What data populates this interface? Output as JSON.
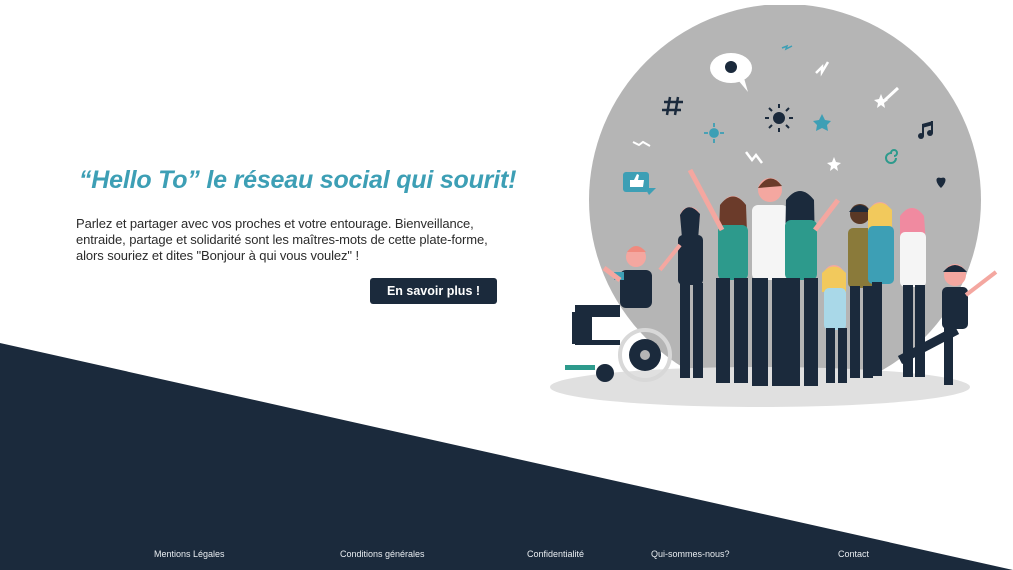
{
  "hero": {
    "title": "“Hello To” le réseau social qui sourit!",
    "description": "Parlez et partager avec vos proches et votre entourage. Bienveillance, entraide, partage et solidarité sont les maîtres-mots de cette plate-forme, alors souriez et dites \"Bonjour à qui vous voulez\" !",
    "cta_label": "En savoir plus !"
  },
  "footer": {
    "links": [
      {
        "label": "Mentions Légales"
      },
      {
        "label": "Conditions générales"
      },
      {
        "label": "Confidentialité"
      },
      {
        "label": "Qui-sommes-nous?"
      },
      {
        "label": "Contact"
      }
    ]
  },
  "colors": {
    "accent": "#3d9fb5",
    "dark": "#1b2a3c",
    "circle": "#b5b5b5",
    "teal": "#2d9a8c"
  },
  "icons": [
    "speech-bubble-icon",
    "hashtag-icon",
    "sun-icon",
    "star-icon",
    "music-note-icon",
    "heart-icon",
    "thumbs-up-icon",
    "spiral-icon",
    "zigzag-icon",
    "wheelchair-icon"
  ]
}
